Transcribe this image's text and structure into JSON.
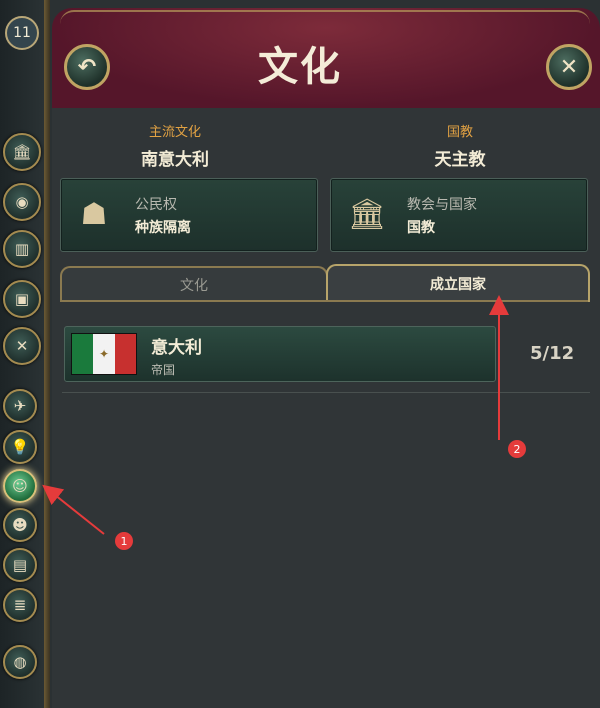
{
  "rail": {
    "level": "11",
    "icons": [
      "government-icon",
      "economy-icon",
      "industry-icon",
      "trade-icon",
      "military-icon",
      "diplomacy-icon",
      "technology-icon",
      "culture-icon",
      "population-icon",
      "journal-icon",
      "decisions-icon",
      "world-icon"
    ]
  },
  "header": {
    "title": "文化",
    "back_icon": "undo-arrow-icon",
    "close_icon": "close-icon"
  },
  "culture": {
    "primary_label": "主流文化",
    "primary_value": "南意大利",
    "religion_label": "国教",
    "religion_value": "天主教"
  },
  "cards": [
    {
      "title": "公民权",
      "value": "种族隔离",
      "icon": "citizenship-busts-icon"
    },
    {
      "title": "教会与国家",
      "value": "国教",
      "icon": "church-state-icon"
    }
  ],
  "tabs": [
    {
      "label": "文化",
      "active": false
    },
    {
      "label": "成立国家",
      "active": true
    }
  ],
  "nations": [
    {
      "name": "意大利",
      "type": "帝国",
      "progress": "5/12",
      "flag": [
        "#1a7a3c",
        "#f2f2f2",
        "#c7302f"
      ]
    }
  ],
  "annotations": {
    "marker1": "1",
    "marker2": "2"
  },
  "colors": {
    "accent": "#e2a243",
    "header": "#6a2233",
    "arrow": "#e53b3b"
  }
}
